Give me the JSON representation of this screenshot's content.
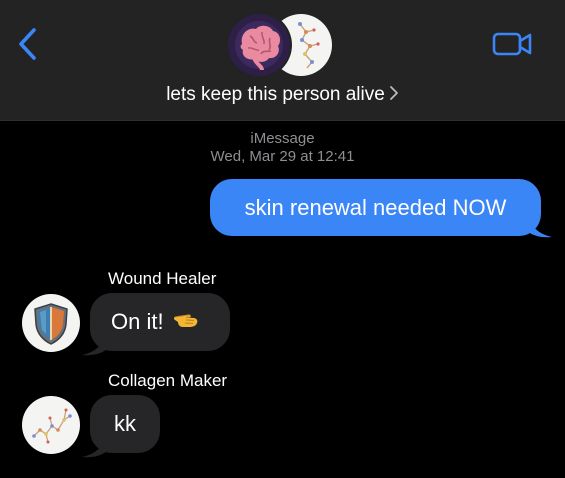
{
  "header": {
    "title": "lets keep this person alive",
    "back_icon": "chevron-left-icon",
    "video_icon": "video-camera-icon",
    "accent": "#3a86f7"
  },
  "thread": {
    "service": "iMessage",
    "timestamp": "Wed, Mar 29 at 12:41"
  },
  "messages": [
    {
      "direction": "outgoing",
      "text": "skin renewal needed NOW",
      "color": "#3a86f7"
    },
    {
      "direction": "incoming",
      "sender": "Wound Healer",
      "text": "On it!",
      "emoji": "pointing-hand-emoji",
      "avatar": "shield-icon",
      "color": "#262628"
    },
    {
      "direction": "incoming",
      "sender": "Collagen Maker",
      "text": "kk",
      "avatar": "molecule-icon",
      "color": "#262628"
    }
  ]
}
